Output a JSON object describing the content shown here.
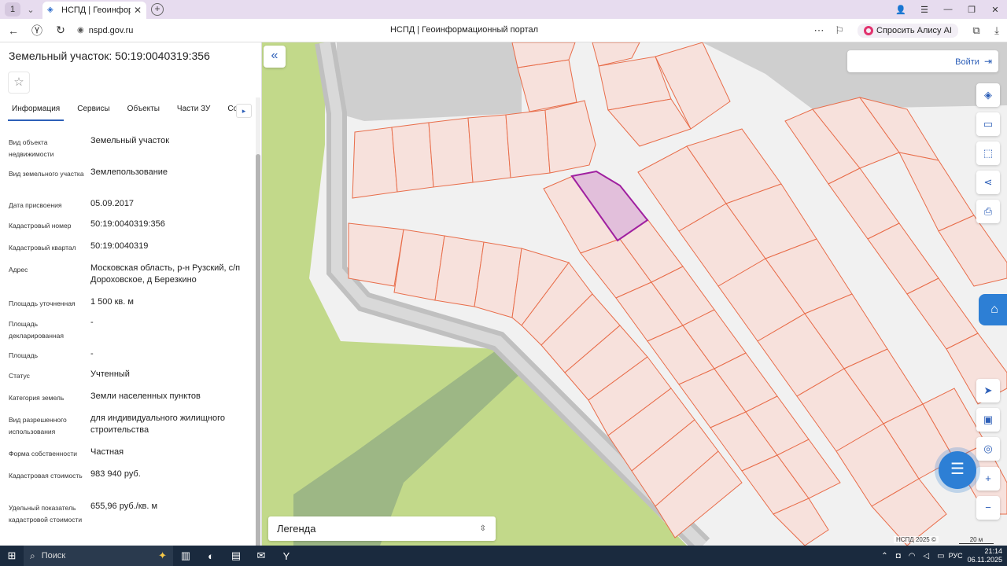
{
  "browser": {
    "tab_count": "1",
    "tab_title": "НСПД | Геоинформац",
    "url": "nspd.gov.ru",
    "page_title": "НСПД | Геоинформационный портал",
    "alice_label": "Спросить Алису AI"
  },
  "panel": {
    "title": "Земельный участок: 50:19:0040319:356",
    "tabs": [
      "Информация",
      "Сервисы",
      "Объекты",
      "Части ЗУ",
      "Соста"
    ],
    "rows": [
      {
        "key": "Вид объекта недвижимости",
        "value": "Земельный участок"
      },
      {
        "key": "Вид земельного участка",
        "value": "Землепользование"
      },
      {
        "key": "Дата присвоения",
        "value": "05.09.2017"
      },
      {
        "key": "Кадастровый номер",
        "value": "50:19:0040319:356"
      },
      {
        "key": "Кадастровый квартал",
        "value": "50:19:0040319"
      },
      {
        "key": "Адрес",
        "value": "Московская область, р-н Рузский, с/п Дороховское, д Березкино"
      },
      {
        "key": "Площадь уточненная",
        "value": "1 500 кв. м"
      },
      {
        "key": "Площадь декларированная",
        "value": "-"
      },
      {
        "key": "Площадь",
        "value": "-"
      },
      {
        "key": "Статус",
        "value": "Учтенный"
      },
      {
        "key": "Категория земель",
        "value": "Земли населенных пунктов"
      },
      {
        "key": "Вид разрешенного использования",
        "value": "для индивидуального жилищного строительства"
      },
      {
        "key": "Форма собственности",
        "value": "Частная"
      },
      {
        "key": "Кадастровая стоимость",
        "value": "983 940 руб."
      },
      {
        "key": "Удельный показатель кадастровой стоимости",
        "value": "655,96 руб./кв. м"
      }
    ]
  },
  "map": {
    "login_label": "Войти",
    "legend_label": "Легенда",
    "copyright": "НСПД 2025 ©",
    "scale": "20 м",
    "colors": {
      "parcel_fill": "#f7e1dc",
      "parcel_stroke": "#e86d4a",
      "selected_fill": "#e2bfdb",
      "selected_stroke": "#a020a0",
      "green": "#c2d98a",
      "road": "#c8c8c8"
    }
  },
  "taskbar": {
    "search_label": "Поиск",
    "lang": "РУС",
    "time": "21:14",
    "date": "06.11.2025"
  }
}
